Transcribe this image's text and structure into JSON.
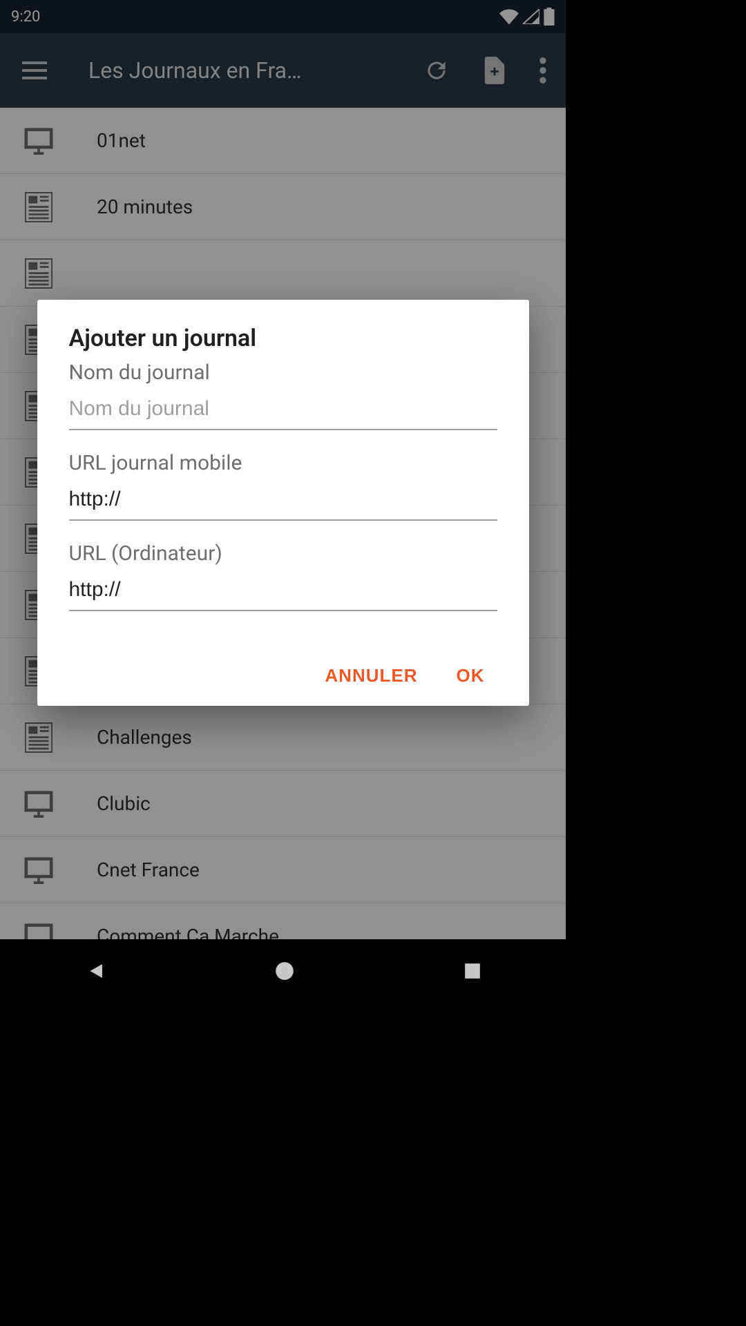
{
  "status": {
    "time": "9:20"
  },
  "appbar": {
    "title": "Les Journaux en Fra…"
  },
  "list_items": [
    {
      "name": "01net",
      "icon": "desktop"
    },
    {
      "name": "20 minutes",
      "icon": "newspaper"
    },
    {
      "name": "",
      "icon": "newspaper"
    },
    {
      "name": "",
      "icon": "newspaper"
    },
    {
      "name": "",
      "icon": "newspaper"
    },
    {
      "name": "",
      "icon": "newspaper"
    },
    {
      "name": "",
      "icon": "newspaper"
    },
    {
      "name": "",
      "icon": "newspaper"
    },
    {
      "name": "",
      "icon": "newspaper"
    },
    {
      "name": "Challenges",
      "icon": "newspaper"
    },
    {
      "name": "Clubic",
      "icon": "desktop"
    },
    {
      "name": "Cnet France",
      "icon": "desktop"
    },
    {
      "name": "Comment Ca Marche",
      "icon": "desktop"
    }
  ],
  "dialog": {
    "title": "Ajouter un journal",
    "field1_label": "Nom du journal",
    "field1_placeholder": "Nom du journal",
    "field1_value": "",
    "field2_label": "URL journal mobile",
    "field2_value": "http://",
    "field3_label": "URL (Ordinateur)",
    "field3_value": "http://",
    "cancel": "ANNULER",
    "ok": "OK"
  }
}
